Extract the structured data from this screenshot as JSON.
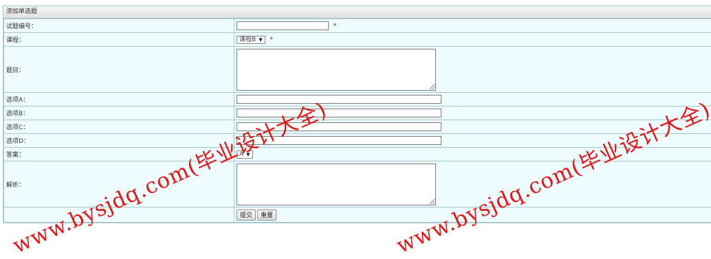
{
  "form": {
    "title": "添加单选题",
    "fields": {
      "code": {
        "label": "试题编号：",
        "required_mark": "*"
      },
      "course": {
        "label": "课程：",
        "selected": "课程B",
        "required_mark": "*"
      },
      "question": {
        "label": "题目："
      },
      "option_a": {
        "label": "选项A："
      },
      "option_b": {
        "label": "选项B："
      },
      "option_c": {
        "label": "选项C："
      },
      "option_d": {
        "label": "选项D："
      },
      "answer": {
        "label": "答案：",
        "selected": "A"
      },
      "analysis": {
        "label": "解析："
      }
    },
    "buttons": {
      "submit": "提交",
      "reset": "重置"
    }
  },
  "watermark": {
    "text": "www.bysjdq.com(毕业设计大全)"
  },
  "icons": {
    "dropdown_arrow": "▼"
  }
}
